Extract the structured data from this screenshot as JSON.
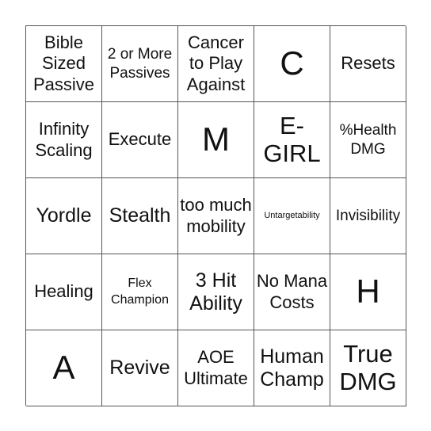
{
  "board": {
    "cells": [
      {
        "text": "Bible Sized Passive",
        "size": "m"
      },
      {
        "text": "2 or More Passives",
        "size": "s"
      },
      {
        "text": "Cancer to Play Against",
        "size": "m"
      },
      {
        "text": "C",
        "size": "xl"
      },
      {
        "text": "Resets",
        "size": "m"
      },
      {
        "text": "Infinity Scaling",
        "size": "m"
      },
      {
        "text": "Execute",
        "size": "m"
      },
      {
        "text": "M",
        "size": "xl"
      },
      {
        "text": "E-GIRL",
        "size": "l"
      },
      {
        "text": "%Health DMG",
        "size": "s"
      },
      {
        "text": "Yordle",
        "size": "ml"
      },
      {
        "text": "Stealth",
        "size": "ml"
      },
      {
        "text": "too much mobility",
        "size": "m"
      },
      {
        "text": "Untargetability",
        "size": "xxs"
      },
      {
        "text": "Invisibility",
        "size": "s"
      },
      {
        "text": "Healing",
        "size": "m"
      },
      {
        "text": "Flex Champion",
        "size": "xs"
      },
      {
        "text": "3 Hit Ability",
        "size": "ml"
      },
      {
        "text": "No Mana Costs",
        "size": "m"
      },
      {
        "text": "H",
        "size": "xl"
      },
      {
        "text": "A",
        "size": "xl"
      },
      {
        "text": "Revive",
        "size": "ml"
      },
      {
        "text": "AOE Ultimate",
        "size": "m"
      },
      {
        "text": "Human Champ",
        "size": "ml"
      },
      {
        "text": "True DMG",
        "size": "l"
      }
    ]
  }
}
